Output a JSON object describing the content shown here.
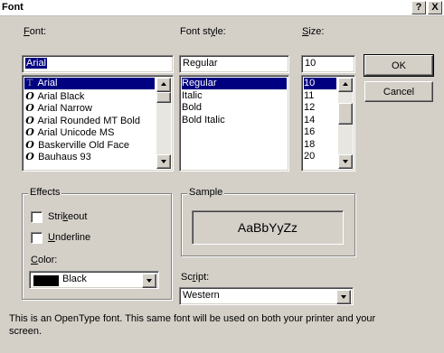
{
  "window": {
    "title": "Font",
    "help_glyph": "?",
    "close_glyph": "X"
  },
  "font": {
    "label": "Font:",
    "value": "Arial",
    "items": [
      {
        "icon": "truetype-icon",
        "glyph": "T",
        "label": "Arial",
        "selected": true
      },
      {
        "icon": "opentype-icon",
        "glyph": "O",
        "label": "Arial Black",
        "selected": false
      },
      {
        "icon": "opentype-icon",
        "glyph": "O",
        "label": "Arial Narrow",
        "selected": false
      },
      {
        "icon": "opentype-icon",
        "glyph": "O",
        "label": "Arial Rounded MT Bold",
        "selected": false
      },
      {
        "icon": "opentype-icon",
        "glyph": "O",
        "label": "Arial Unicode MS",
        "selected": false
      },
      {
        "icon": "opentype-icon",
        "glyph": "O",
        "label": "Baskerville Old Face",
        "selected": false
      },
      {
        "icon": "opentype-icon",
        "glyph": "O",
        "label": "Bauhaus 93",
        "selected": false
      }
    ]
  },
  "style": {
    "label": "Font style:",
    "value": "Regular",
    "items": [
      {
        "label": "Regular",
        "selected": true
      },
      {
        "label": "Italic",
        "selected": false
      },
      {
        "label": "Bold",
        "selected": false
      },
      {
        "label": "Bold Italic",
        "selected": false
      }
    ]
  },
  "size": {
    "label": "Size:",
    "value": "10",
    "items": [
      {
        "label": "10",
        "selected": true
      },
      {
        "label": "11",
        "selected": false
      },
      {
        "label": "12",
        "selected": false
      },
      {
        "label": "14",
        "selected": false
      },
      {
        "label": "16",
        "selected": false
      },
      {
        "label": "18",
        "selected": false
      },
      {
        "label": "20",
        "selected": false
      }
    ]
  },
  "buttons": {
    "ok": "OK",
    "cancel": "Cancel"
  },
  "effects": {
    "label": "Effects",
    "strikeout": "Strikeout",
    "underline": "Underline",
    "color_label": "Color:",
    "color_value": "Black",
    "color_swatch": "#000000"
  },
  "sample": {
    "label": "Sample",
    "text": "AaBbYyZz"
  },
  "script": {
    "label": "Script:",
    "value": "Western"
  },
  "description": "This is an OpenType font. This same font will be used on both your printer and your screen.",
  "colors": {
    "face": "#d4d0c8",
    "highlight": "#000080",
    "window": "#ffffff"
  }
}
